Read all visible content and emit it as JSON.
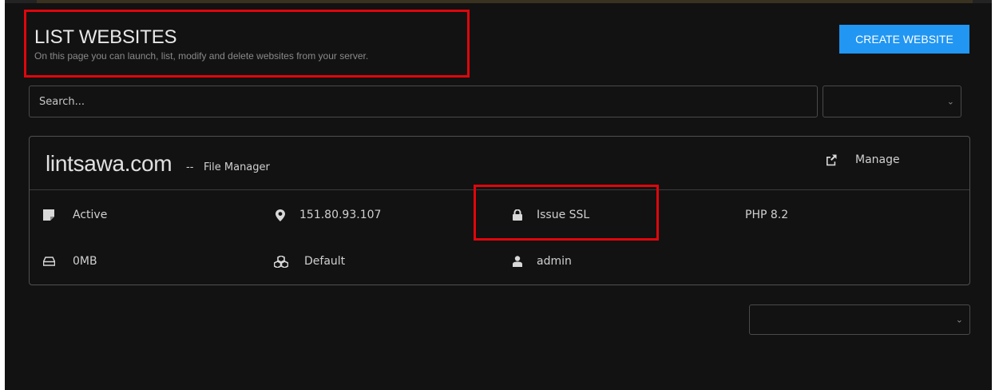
{
  "header": {
    "title": "LIST WEBSITES",
    "subtitle": "On this page you can launch, list, modify and delete websites from your server.",
    "create_button": "CREATE WEBSITE"
  },
  "search": {
    "placeholder": "Search...",
    "filter_select_value": ""
  },
  "website": {
    "domain": "lintsawa.com",
    "separator": "--",
    "file_manager": "File Manager",
    "manage_label": "Manage",
    "status": "Active",
    "ip": "151.80.93.107",
    "ssl": "Issue SSL",
    "php": "PHP 8.2",
    "disk_usage": "0MB",
    "package": "Default",
    "owner": "admin"
  },
  "pagination": {
    "select_value": ""
  },
  "colors": {
    "background": "#121212",
    "accent": "#2196f3",
    "highlight": "#e0060c"
  }
}
